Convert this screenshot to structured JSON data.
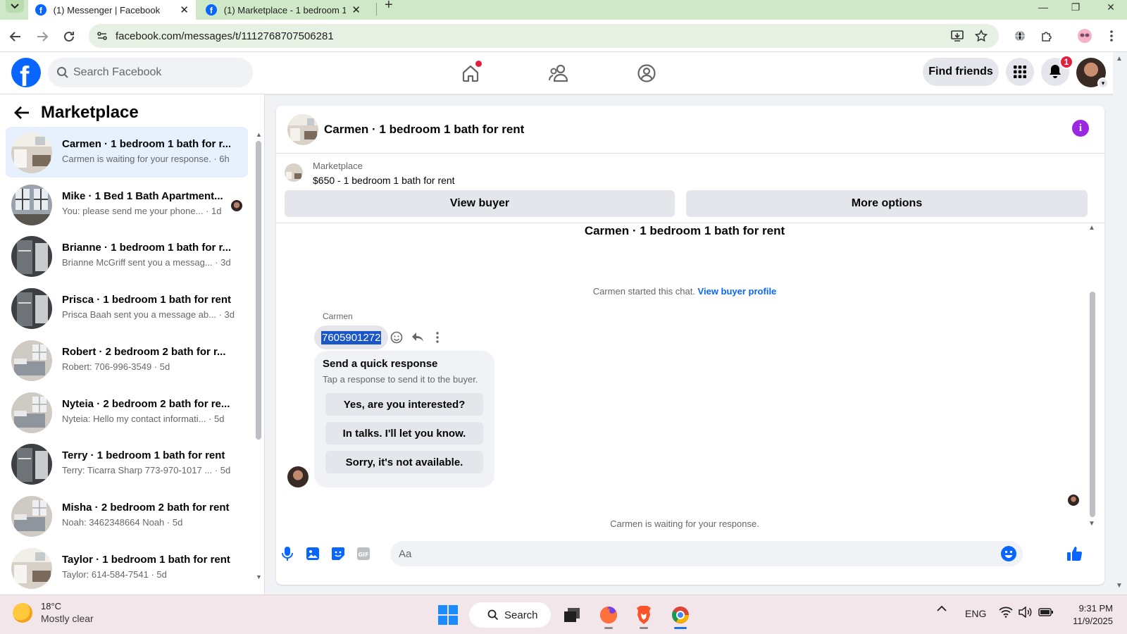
{
  "browser": {
    "tabs": [
      {
        "title": "(1) Messenger | Facebook",
        "active": true
      },
      {
        "title": "(1) Marketplace - 1 bedroom 1",
        "active": false
      }
    ],
    "url": "facebook.com/messages/t/1112768707506281"
  },
  "fb_nav": {
    "logo_letter": "f",
    "search_placeholder": "Search Facebook",
    "find_friends": "Find friends",
    "notification_count": "1"
  },
  "sidebar": {
    "title": "Marketplace",
    "conversations": [
      {
        "name": "Carmen · 1 bedroom 1 bath for r...",
        "preview": "Carmen is waiting for your response. · 6h",
        "selected": true,
        "thumb": "kitchen"
      },
      {
        "name": "Mike · 1 Bed 1 Bath Apartment...",
        "preview": "You: please send me your phone... · 1d",
        "selected": false,
        "thumb": "windows"
      },
      {
        "name": "Brianne · 1 bedroom 1 bath for r...",
        "preview": "Brianne McGriff sent you a messag... · 3d",
        "selected": false,
        "thumb": "bath"
      },
      {
        "name": "Prisca · 1 bedroom 1 bath for rent",
        "preview": "Prisca Baah sent you a message ab... · 3d",
        "selected": false,
        "thumb": "bath"
      },
      {
        "name": "Robert · 2 bedroom 2 bath for r...",
        "preview": "Robert: 706-996-3549 · 5d",
        "selected": false,
        "thumb": "bedroom"
      },
      {
        "name": "Nyteia · 2 bedroom 2 bath for re...",
        "preview": "Nyteia: Hello my contact informati... · 5d",
        "selected": false,
        "thumb": "bedroom"
      },
      {
        "name": "Terry · 1 bedroom 1 bath for rent",
        "preview": "Terry: Ticarra Sharp 773-970-1017 ... · 5d",
        "selected": false,
        "thumb": "bath"
      },
      {
        "name": "Misha · 2 bedroom 2 bath for rent",
        "preview": "Noah: 3462348664 Noah · 5d",
        "selected": false,
        "thumb": "bedroom"
      },
      {
        "name": "Taylor · 1 bedroom 1 bath for rent",
        "preview": "Taylor: 614-584-7541 · 5d",
        "selected": false,
        "thumb": "kitchen"
      }
    ]
  },
  "chat": {
    "header_name": "Carmen · 1 bedroom 1 bath for rent",
    "marketplace_label": "Marketplace",
    "listing": "$650 - 1 bedroom 1 bath for rent",
    "view_buyer": "View buyer",
    "more_options": "More options",
    "conversation_title": "Carmen · 1 bedroom 1 bath for rent",
    "started_text": "Carmen started this chat.",
    "view_buyer_profile": "View buyer profile",
    "sender": "Carmen",
    "message": "7605901272",
    "quick_response": {
      "title": "Send a quick response",
      "subtitle": "Tap a response to send it to the buyer.",
      "options": [
        "Yes, are you interested?",
        "In talks. I'll let you know.",
        "Sorry, it's not available."
      ]
    },
    "waiting_text": "Carmen is waiting for your response.",
    "input_placeholder": "Aa"
  },
  "taskbar": {
    "temp": "18°C",
    "weather": "Mostly clear",
    "search_label": "Search",
    "language": "ENG",
    "time": "9:31 PM",
    "date": "11/9/2025"
  },
  "colors": {
    "fb_blue": "#0866ff",
    "selected_row": "#e7f0fd",
    "badge_red": "#e41e3f",
    "info_purple": "#9c27e0"
  }
}
